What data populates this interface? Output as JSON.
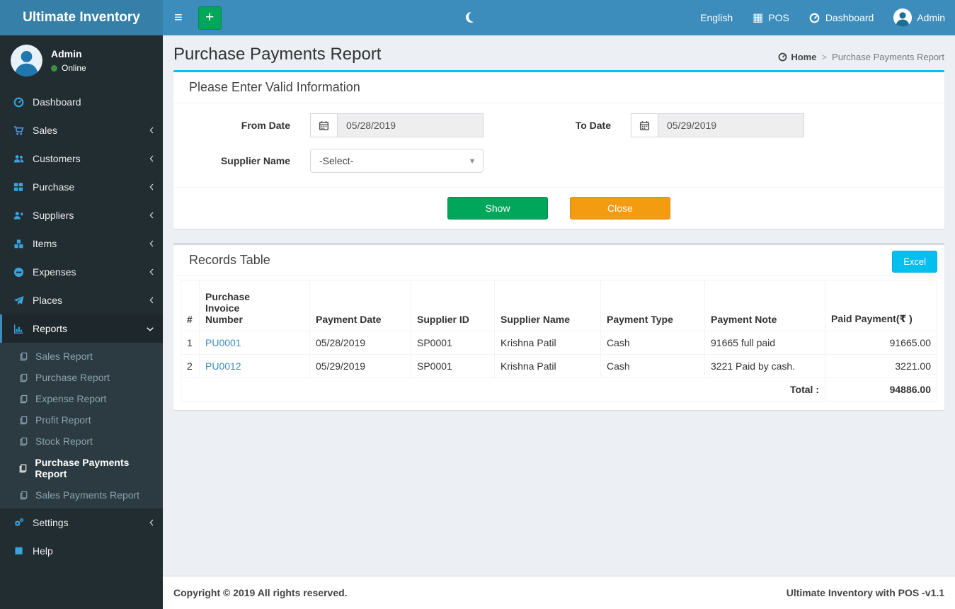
{
  "icons": {
    "hamburger": "≡",
    "add": "+",
    "pos_grid": "▦",
    "caret_down": "▾"
  },
  "navbar": {
    "brand": "Ultimate Inventory",
    "language": "English",
    "pos": "POS",
    "dashboard": "Dashboard",
    "user": "Admin"
  },
  "sidebar": {
    "user": {
      "name": "Admin",
      "status": "Online"
    },
    "items": [
      {
        "label": "Dashboard"
      },
      {
        "label": "Sales"
      },
      {
        "label": "Customers"
      },
      {
        "label": "Purchase"
      },
      {
        "label": "Suppliers"
      },
      {
        "label": "Items"
      },
      {
        "label": "Expenses"
      },
      {
        "label": "Places"
      },
      {
        "label": "Reports"
      }
    ],
    "reports_submenu": [
      "Sales Report",
      "Purchase Report",
      "Expense Report",
      "Profit Report",
      "Stock Report",
      "Purchase Payments Report",
      "Sales Payments Report"
    ],
    "bottom_items": [
      "Settings",
      "Help"
    ]
  },
  "page": {
    "title": "Purchase Payments Report",
    "breadcrumb": {
      "home": "Home",
      "current": "Purchase Payments Report"
    }
  },
  "filter": {
    "box_title": "Please Enter Valid Information",
    "from_date": {
      "label": "From Date",
      "value": "05/28/2019"
    },
    "to_date": {
      "label": "To Date",
      "value": "05/29/2019"
    },
    "supplier": {
      "label": "Supplier Name",
      "value": "-Select-"
    },
    "show_button": "Show",
    "close_button": "Close"
  },
  "records": {
    "box_title": "Records Table",
    "excel_button": "Excel",
    "columns": [
      "#",
      "Purchase Invoice Number",
      "Payment Date",
      "Supplier ID",
      "Supplier Name",
      "Payment Type",
      "Payment Note",
      "Paid Payment(₹ )"
    ],
    "rows": [
      {
        "sn": "1",
        "invoice": "PU0001",
        "date": "05/28/2019",
        "supplier_id": "SP0001",
        "supplier_name": "Krishna Patil",
        "type": "Cash",
        "note": "91665 full paid",
        "paid": "91665.00"
      },
      {
        "sn": "2",
        "invoice": "PU0012",
        "date": "05/29/2019",
        "supplier_id": "SP0001",
        "supplier_name": "Krishna Patil",
        "type": "Cash",
        "note": "3221 Paid by cash.",
        "paid": "3221.00"
      }
    ],
    "total_label": "Total :",
    "total_value": "94886.00"
  },
  "footer": {
    "left": "Copyright © 2019 All rights reserved.",
    "right": "Ultimate Inventory with POS -v1.1"
  },
  "colors": {
    "navbar": "#3c8dbc",
    "accent": "#00c0ef",
    "success": "#00a65a",
    "warning": "#f39c12",
    "link": "#3c8dbc"
  }
}
